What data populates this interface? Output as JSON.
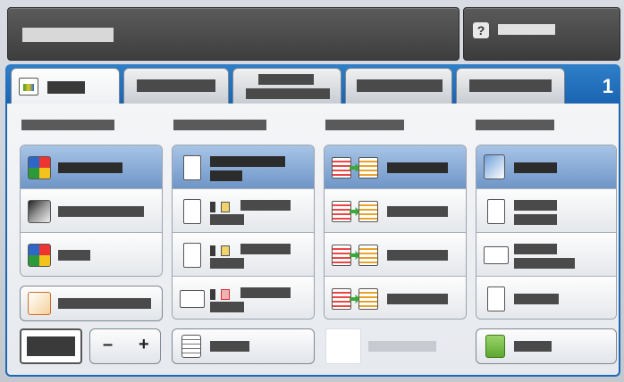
{
  "status": {
    "tab_count": "1",
    "help_glyph": "?"
  },
  "icons": [
    "help-icon",
    "copy-tab-icon",
    "output-color-icon",
    "paper-supply-icon",
    "two-sided-icon",
    "reduce-enlarge-icon",
    "original-orientation-icon",
    "paper-tray-icon"
  ],
  "stepper": {
    "minus": "–",
    "plus": "+"
  }
}
